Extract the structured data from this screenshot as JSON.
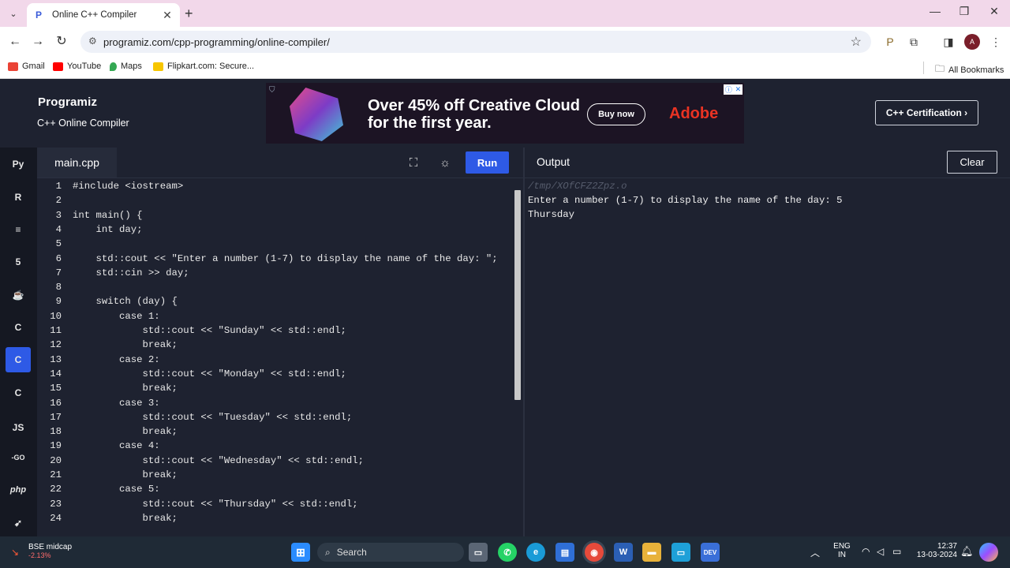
{
  "browser": {
    "tab_title": "Online C++ Compiler",
    "url": "programiz.com/cpp-programming/online-compiler/",
    "bookmarks": [
      {
        "label": "Gmail",
        "color": "#ea4335"
      },
      {
        "label": "YouTube",
        "color": "#ff0000"
      },
      {
        "label": "Maps",
        "color": "#34a853"
      },
      {
        "label": "Flipkart.com: Secure...",
        "color": "#f7c600"
      }
    ],
    "all_bookmarks": "All Bookmarks",
    "profile_initial": "A"
  },
  "site": {
    "logo": "Programiz",
    "subtitle": "C++ Online Compiler",
    "certification": "C++ Certification ›"
  },
  "ad": {
    "headline": "Over 45% off Creative Cloud for the first year.",
    "cta": "Buy now",
    "brand": "Adobe"
  },
  "sidebar": [
    {
      "name": "python",
      "label": "Py",
      "active": false
    },
    {
      "name": "r",
      "label": "R",
      "active": false
    },
    {
      "name": "sql",
      "label": "≡",
      "active": false
    },
    {
      "name": "html",
      "label": "5",
      "active": false
    },
    {
      "name": "java",
      "label": "☕",
      "active": false
    },
    {
      "name": "c",
      "label": "C",
      "active": false
    },
    {
      "name": "cpp",
      "label": "C",
      "active": true
    },
    {
      "name": "csharp",
      "label": "C",
      "active": false
    },
    {
      "name": "js",
      "label": "JS",
      "active": false
    },
    {
      "name": "go",
      "label": "-GO",
      "active": false
    },
    {
      "name": "php",
      "label": "php",
      "active": false
    },
    {
      "name": "swift",
      "label": "➹",
      "active": false
    }
  ],
  "editor": {
    "filename": "main.cpp",
    "run_label": "Run",
    "lines": [
      "#include <iostream>",
      "",
      "int main() {",
      "    int day;",
      "",
      "    std::cout << \"Enter a number (1-7) to display the name of the day: \";",
      "    std::cin >> day;",
      "",
      "    switch (day) {",
      "        case 1:",
      "            std::cout << \"Sunday\" << std::endl;",
      "            break;",
      "        case 2:",
      "            std::cout << \"Monday\" << std::endl;",
      "            break;",
      "        case 3:",
      "            std::cout << \"Tuesday\" << std::endl;",
      "            break;",
      "        case 4:",
      "            std::cout << \"Wednesday\" << std::endl;",
      "            break;",
      "        case 5:",
      "            std::cout << \"Thursday\" << std::endl;",
      "            break;"
    ]
  },
  "output": {
    "label": "Output",
    "clear_label": "Clear",
    "path": "/tmp/XOfCFZ2Zpz.o",
    "lines": [
      "Enter a number (1-7) to display the name of the day: 5",
      "Thursday"
    ]
  },
  "taskbar": {
    "stock_name": "BSE midcap",
    "stock_change": "-2.13%",
    "search_label": "Search",
    "lang_top": "ENG",
    "lang_bottom": "IN",
    "time": "12:37",
    "date": "13-03-2024"
  }
}
